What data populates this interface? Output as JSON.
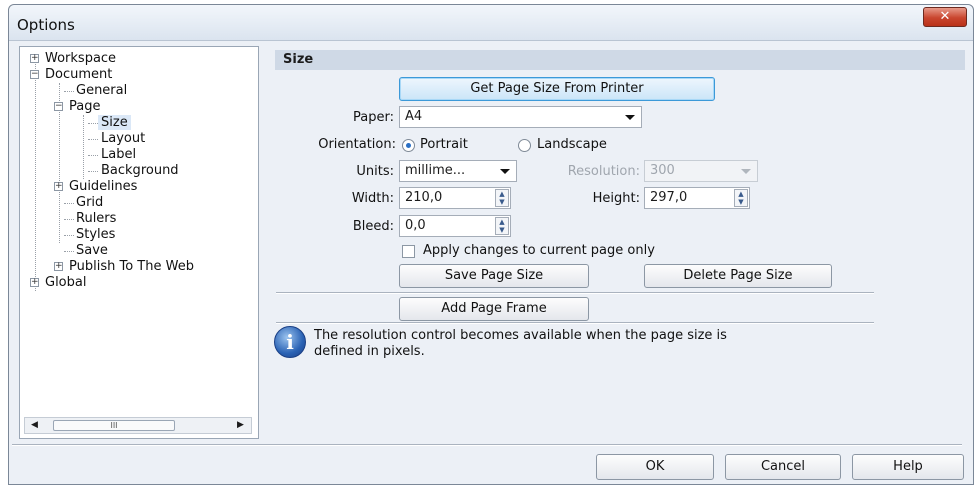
{
  "window": {
    "title": "Options",
    "close_glyph": "✕"
  },
  "tree": {
    "items": [
      {
        "label": "Workspace",
        "expander": "+"
      },
      {
        "label": "Document",
        "expander": "−"
      },
      {
        "label": "General"
      },
      {
        "label": "Page",
        "expander": "−"
      },
      {
        "label": "Size",
        "selected": true
      },
      {
        "label": "Layout"
      },
      {
        "label": "Label"
      },
      {
        "label": "Background"
      },
      {
        "label": "Guidelines",
        "expander": "+"
      },
      {
        "label": "Grid"
      },
      {
        "label": "Rulers"
      },
      {
        "label": "Styles"
      },
      {
        "label": "Save"
      },
      {
        "label": "Publish To The Web",
        "expander": "+"
      },
      {
        "label": "Global",
        "expander": "+"
      }
    ],
    "scroll_thumb_grip": "III"
  },
  "size_panel": {
    "header": "Size",
    "get_page_size_button": "Get Page Size From Printer",
    "paper_label": "Paper:",
    "paper_value": "A4",
    "orientation_label": "Orientation:",
    "portrait_label": "Portrait",
    "landscape_label": "Landscape",
    "orientation_selected": "Portrait",
    "units_label": "Units:",
    "units_value": "millime...",
    "resolution_label": "Resolution:",
    "resolution_value": "300",
    "width_label": "Width:",
    "width_value": "210,0",
    "height_label": "Height:",
    "height_value": "297,0",
    "bleed_label": "Bleed:",
    "bleed_value": "0,0",
    "apply_changes_label": "Apply changes to current page only",
    "apply_changes_checked": false,
    "save_page_size_button": "Save Page Size",
    "delete_page_size_button": "Delete Page Size",
    "add_page_frame_button": "Add Page Frame",
    "info_icon_glyph": "i",
    "info_line1": "The resolution control becomes available when the page size is",
    "info_line2": "defined in pixels."
  },
  "footer": {
    "ok_button": "OK",
    "cancel_button": "Cancel",
    "help_button": "Help"
  },
  "colors": {
    "dialog_background": "#ecf0f6",
    "section_header": "#cfd9e6",
    "close_button": "#c9452e",
    "focus_button_border": "#3c99d8",
    "selected_tree_item": "#dbe8f7"
  }
}
